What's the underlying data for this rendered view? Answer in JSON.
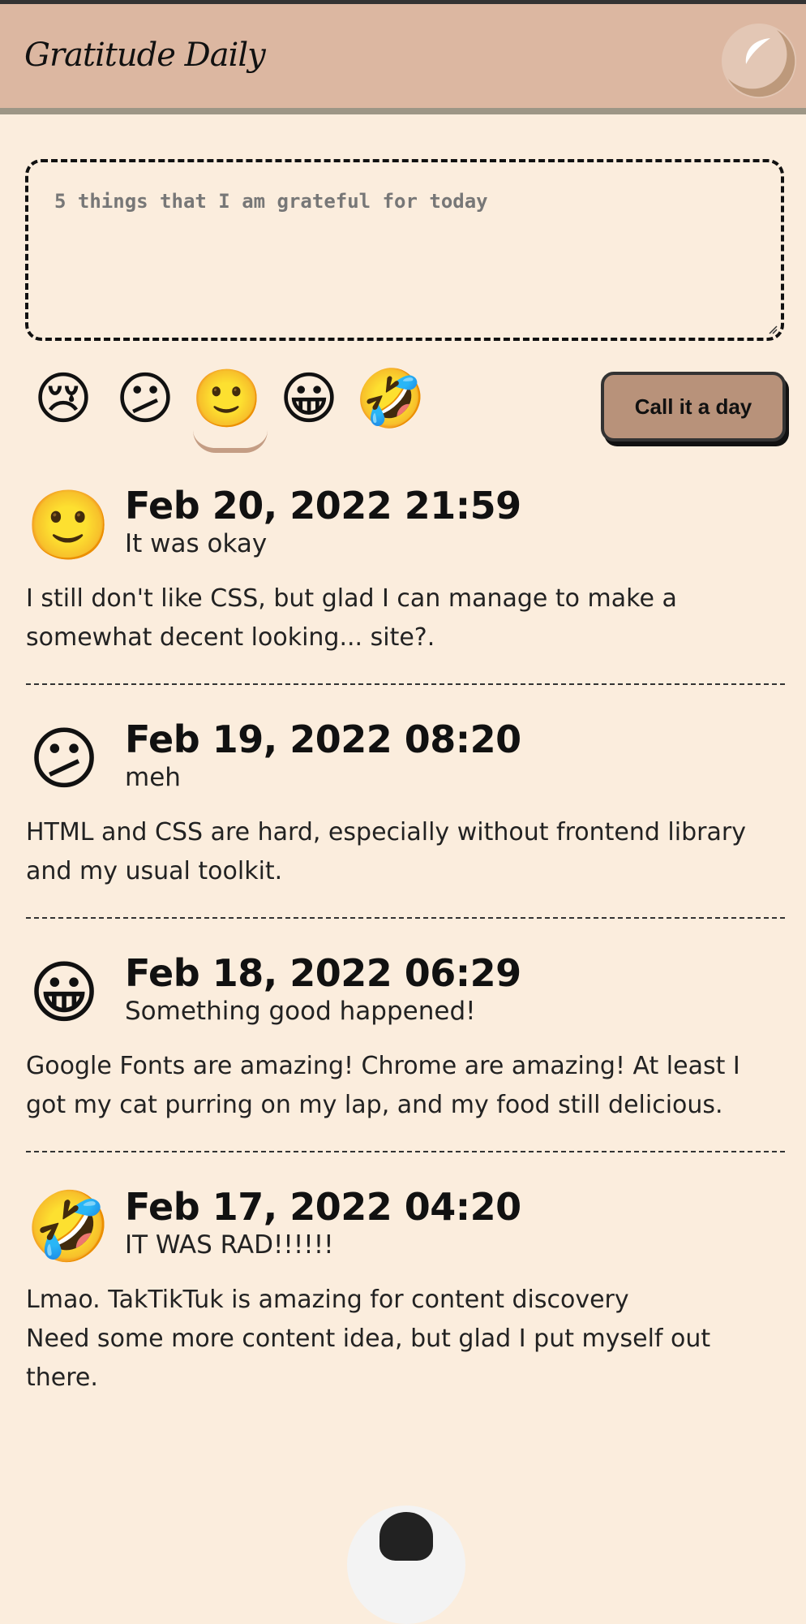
{
  "app": {
    "title": "Gratitude Daily"
  },
  "header": {
    "icon": "moon-crescent-icon"
  },
  "composer": {
    "placeholder": "5 things that I am grateful for today",
    "value": ""
  },
  "moods": [
    {
      "emoji": "😢",
      "icon": "crying-face-icon",
      "selected": false
    },
    {
      "emoji": "😕",
      "icon": "confused-face-icon",
      "selected": false
    },
    {
      "emoji": "🙂",
      "icon": "slightly-smiling-face-icon",
      "selected": true
    },
    {
      "emoji": "😀",
      "icon": "grinning-face-icon",
      "selected": false
    },
    {
      "emoji": "🤣",
      "icon": "rolling-laughing-face-icon",
      "selected": false
    }
  ],
  "actions": {
    "submit_label": "Call it a day"
  },
  "entries": [
    {
      "emoji": "🙂",
      "date": "Feb 20, 2022 21:59",
      "mood_label": "It was okay",
      "body": "I still don't like CSS, but glad I can manage to make a somewhat decent looking... site?."
    },
    {
      "emoji": "😕",
      "date": "Feb 19, 2022 08:20",
      "mood_label": "meh",
      "body": "HTML and CSS are hard, especially without frontend library and my usual toolkit."
    },
    {
      "emoji": "😀",
      "date": "Feb 18, 2022 06:29",
      "mood_label": "Something good happened!",
      "body": "Google Fonts are amazing! Chrome are amazing! At least I got my cat purring on my lap, and my food still delicious."
    },
    {
      "emoji": "🤣",
      "date": "Feb 17, 2022 04:20",
      "mood_label": "IT WAS RAD!!!!!!",
      "body": "Lmao. TakTikTuk is amazing for content discovery\nNeed some more content idea, but glad I put myself out there."
    }
  ],
  "colors": {
    "background": "#fbeddd",
    "header": "#dcb7a1",
    "button": "#b8927a",
    "accent": "#c49d84"
  }
}
